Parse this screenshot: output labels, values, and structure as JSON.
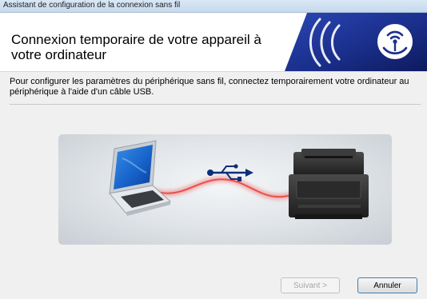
{
  "window": {
    "title": "Assistant de configuration de la connexion sans fil"
  },
  "header": {
    "title": "Connexion temporaire de votre appareil à votre ordinateur",
    "banner_icon": "wireless-signal-icon",
    "banner_color": "#1a2f8c"
  },
  "main": {
    "instructions": "Pour configurer les paramètres du périphérique sans fil, connectez temporairement votre ordinateur au périphérique à l'aide d'un câble USB.",
    "illustration": {
      "items": [
        "laptop-icon",
        "usb-icon",
        "printer-icon"
      ],
      "cable_color": "#e8504a"
    }
  },
  "footer": {
    "next_label": "Suivant >",
    "next_disabled": true,
    "cancel_label": "Annuler"
  }
}
